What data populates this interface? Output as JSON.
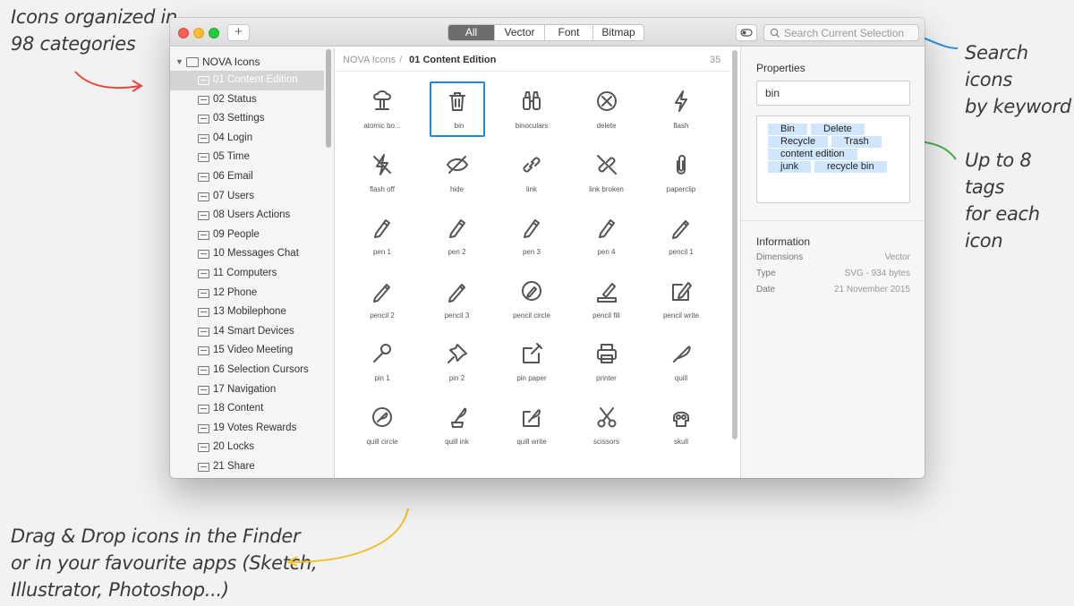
{
  "annotations": {
    "categories_line1": "Icons organized in",
    "categories_line2": "98 categories",
    "search_line1": "Search icons",
    "search_line2": "by keyword",
    "tags_line1": "Up to 8 tags",
    "tags_line2": "for each icon",
    "drag_line1": "Drag & Drop icons in the Finder",
    "drag_line2": "or in your favourite apps (Sketch,",
    "drag_line3": "Illustrator, Photoshop...)"
  },
  "colors": {
    "arrow_red": "#e8483c",
    "arrow_blue": "#2b8fe0",
    "arrow_green": "#3fae4a",
    "arrow_yellow": "#f2c12e",
    "selection": "#1f8ad9",
    "tag_bg": "#cfe6fc"
  },
  "toolbar": {
    "add_label": "+",
    "filters": [
      "All",
      "Vector",
      "Font",
      "Bitmap"
    ],
    "active_filter": "All",
    "search_placeholder": "Search Current Selection"
  },
  "sidebar": {
    "root": "NOVA Icons",
    "items": [
      "01 Content Edition",
      "02 Status",
      "03 Settings",
      "04 Login",
      "05 Time",
      "06 Email",
      "07 Users",
      "08 Users Actions",
      "09 People",
      "10 Messages Chat",
      "11 Computers",
      "12 Phone",
      "13 Mobilephone",
      "14 Smart Devices",
      "15 Video Meeting",
      "16 Selection Cursors",
      "17 Navigation",
      "18 Content",
      "19 Votes Rewards",
      "20 Locks",
      "21 Share"
    ],
    "active": "01 Content Edition"
  },
  "content": {
    "breadcrumb_root": "NOVA Icons",
    "breadcrumb_separator": "/",
    "breadcrumb_current": "01 Content Edition",
    "count": "35",
    "icons": [
      {
        "name": "atomic bo...",
        "icon": "atomic-bomb-icon"
      },
      {
        "name": "bin",
        "icon": "bin-icon"
      },
      {
        "name": "binoculars",
        "icon": "binoculars-icon"
      },
      {
        "name": "delete",
        "icon": "delete-icon"
      },
      {
        "name": "flash",
        "icon": "flash-icon"
      },
      {
        "name": "flash off",
        "icon": "flash-off-icon"
      },
      {
        "name": "hide",
        "icon": "hide-icon"
      },
      {
        "name": "link",
        "icon": "link-icon"
      },
      {
        "name": "link broken",
        "icon": "link-broken-icon"
      },
      {
        "name": "paperclip",
        "icon": "paperclip-icon"
      },
      {
        "name": "pen 1",
        "icon": "pen-icon"
      },
      {
        "name": "pen 2",
        "icon": "pen-icon"
      },
      {
        "name": "pen 3",
        "icon": "pen-icon"
      },
      {
        "name": "pen 4",
        "icon": "pen-icon"
      },
      {
        "name": "pencil 1",
        "icon": "pencil-icon"
      },
      {
        "name": "pencil 2",
        "icon": "pencil-icon"
      },
      {
        "name": "pencil 3",
        "icon": "pencil-icon"
      },
      {
        "name": "pencil circle",
        "icon": "pencil-circle-icon"
      },
      {
        "name": "pencil fill",
        "icon": "pencil-fill-icon"
      },
      {
        "name": "pencil write",
        "icon": "pencil-write-icon"
      },
      {
        "name": "pin 1",
        "icon": "pin-icon"
      },
      {
        "name": "pin 2",
        "icon": "pushpin-icon"
      },
      {
        "name": "pin paper",
        "icon": "pin-paper-icon"
      },
      {
        "name": "printer",
        "icon": "printer-icon"
      },
      {
        "name": "quill",
        "icon": "quill-icon"
      },
      {
        "name": "quill circle",
        "icon": "quill-circle-icon"
      },
      {
        "name": "quill ink",
        "icon": "quill-ink-icon"
      },
      {
        "name": "quill write",
        "icon": "quill-write-icon"
      },
      {
        "name": "scissors",
        "icon": "scissors-icon"
      },
      {
        "name": "skull",
        "icon": "skull-icon"
      }
    ],
    "selected": "bin"
  },
  "properties": {
    "title": "Properties",
    "name_value": "bin",
    "tags": [
      "Bin",
      "Delete",
      "Recycle",
      "Trash",
      "content edition",
      "junk",
      "recycle bin"
    ]
  },
  "information": {
    "title": "Information",
    "rows": [
      {
        "key": "Dimensions",
        "value": "Vector"
      },
      {
        "key": "Type",
        "value": "SVG - 934 bytes"
      },
      {
        "key": "Date",
        "value": "21 November 2015"
      }
    ]
  }
}
